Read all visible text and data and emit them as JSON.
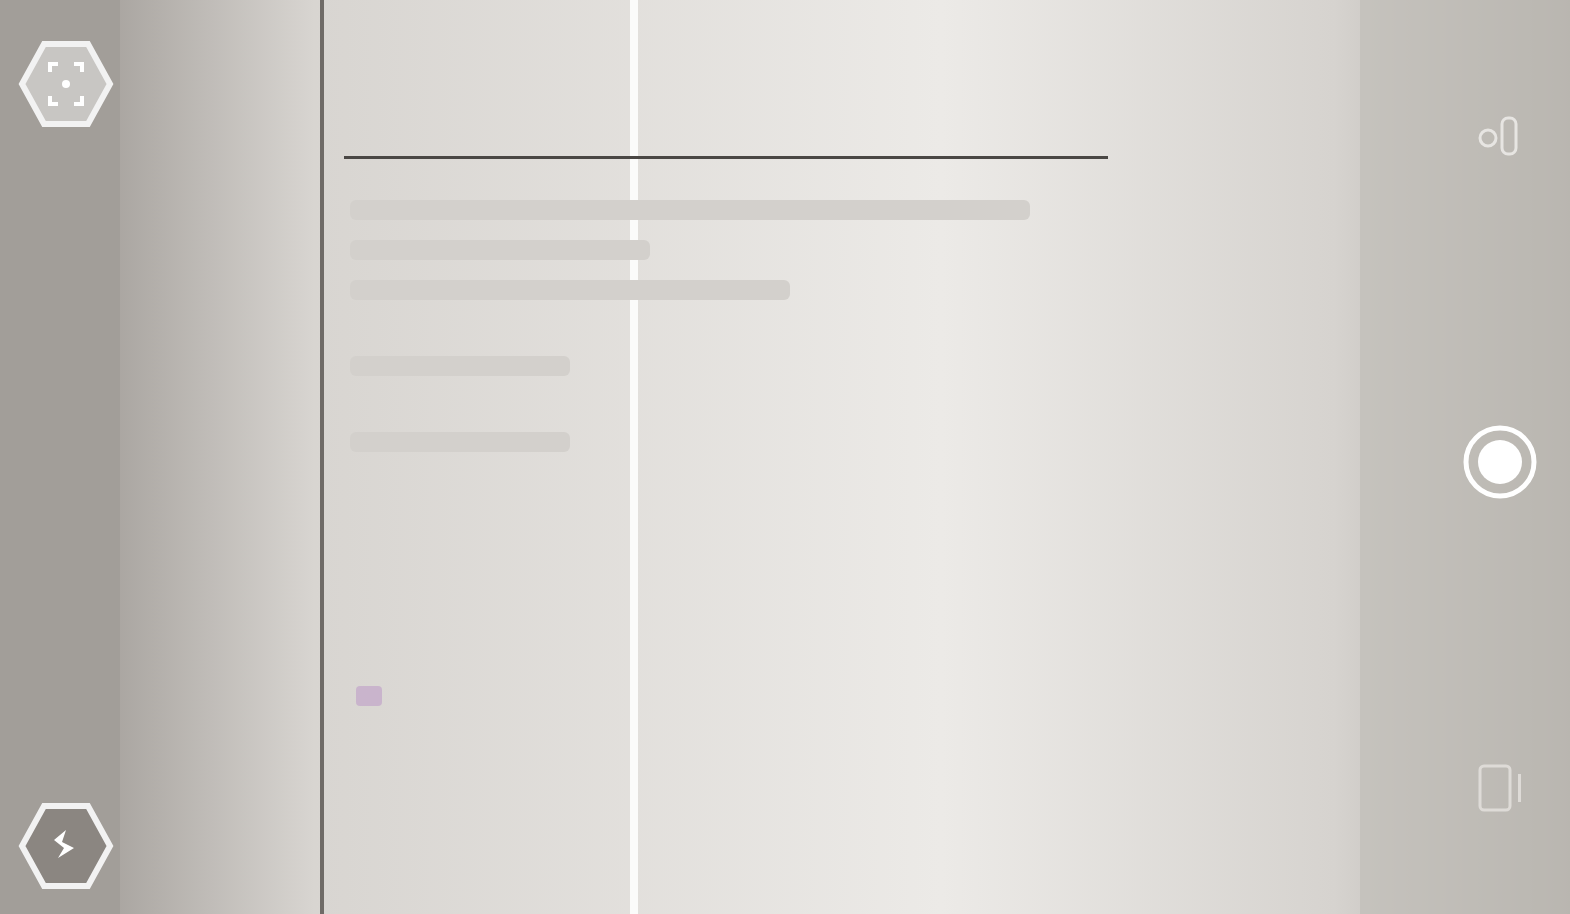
{
  "left_controls": [
    {
      "kind": "focus"
    },
    {
      "kind": "flash"
    }
  ],
  "right_controls": [
    {
      "kind": "switch-camera"
    },
    {
      "kind": "shutter"
    },
    {
      "kind": "video"
    }
  ]
}
